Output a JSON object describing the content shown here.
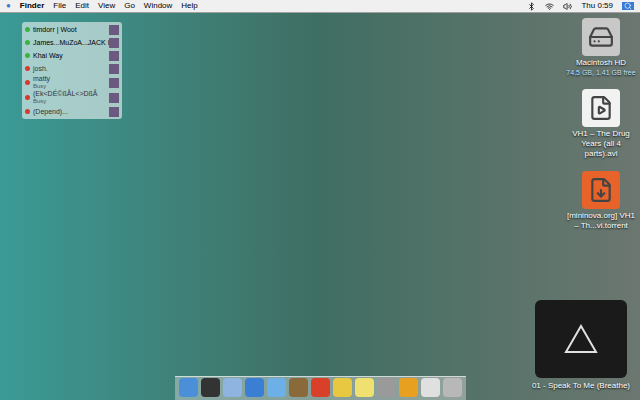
{
  "menu_bar": {
    "apple": "",
    "app": "Finder",
    "menus": [
      "File",
      "Edit",
      "View",
      "Go",
      "Window",
      "Help"
    ],
    "clock": "Thu 0:59"
  },
  "buddy_list": [
    {
      "name": "timdorr | Woot",
      "status": "",
      "available": true,
      "color": "#3cb43c"
    },
    {
      "name": "James...MuZoA...JACK I...",
      "status": "",
      "available": true,
      "color": "#3cb43c"
    },
    {
      "name": "Khai Way",
      "status": "",
      "available": true,
      "color": "#3cb43c"
    },
    {
      "name": "josh.",
      "status": "",
      "available": false,
      "color": "#d63a2f"
    },
    {
      "name": "matty",
      "status": "Busy",
      "available": false,
      "color": "#d63a2f"
    },
    {
      "name": "(Ek<DÉ©ßÅL<>DßÅ",
      "status": "Busy",
      "available": false,
      "color": "#d63a2f"
    },
    {
      "name": "(Depend)...",
      "status": "",
      "available": false,
      "color": "#d63a2f"
    }
  ],
  "desktop_icons": [
    {
      "kind": "drive",
      "label": "Macintosh HD",
      "info": "74.5 GB, 1.41 GB free"
    },
    {
      "kind": "video",
      "label": "VH1 – The Drug Years (all 4 parts).avi",
      "info": ""
    },
    {
      "kind": "torrent",
      "label": "[mininova.org] VH1 – Th...vi.torrent",
      "info": ""
    }
  ],
  "mini_player": {
    "track": "01 - Speak To Me (Breathe)"
  },
  "dock": {
    "items": [
      {
        "kind": "finder"
      },
      {
        "kind": "dashboard"
      },
      {
        "kind": "mail"
      },
      {
        "kind": "safari"
      },
      {
        "kind": "itunes"
      },
      {
        "kind": "iphoto"
      },
      {
        "kind": "tomato"
      },
      {
        "kind": "adium"
      },
      {
        "kind": "stickies"
      },
      {
        "kind": "prefs"
      },
      {
        "kind": "office"
      },
      {
        "kind": "preview"
      },
      {
        "kind": "trash"
      }
    ]
  }
}
